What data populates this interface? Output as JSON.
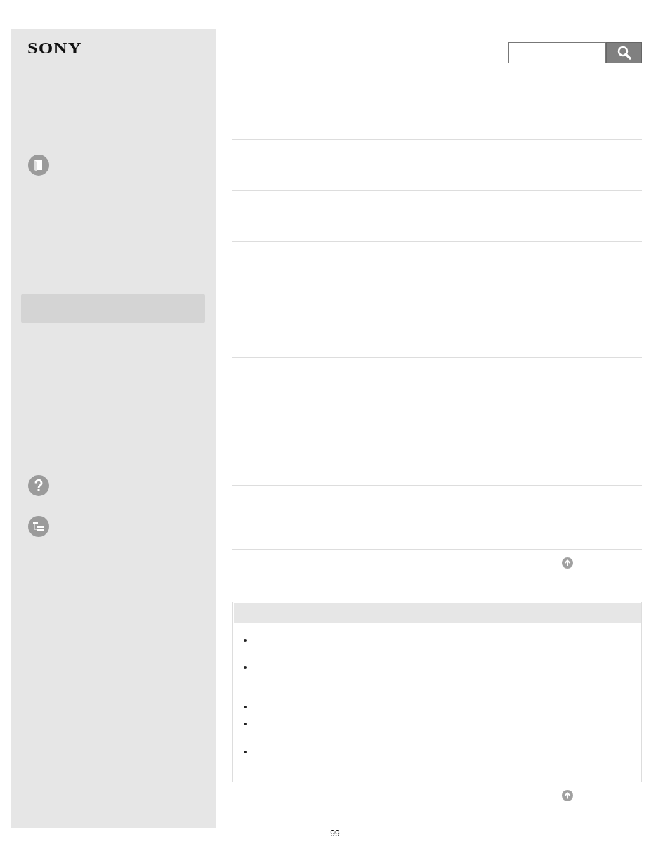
{
  "logo": {
    "text": "SONY"
  },
  "page_number": "99"
}
